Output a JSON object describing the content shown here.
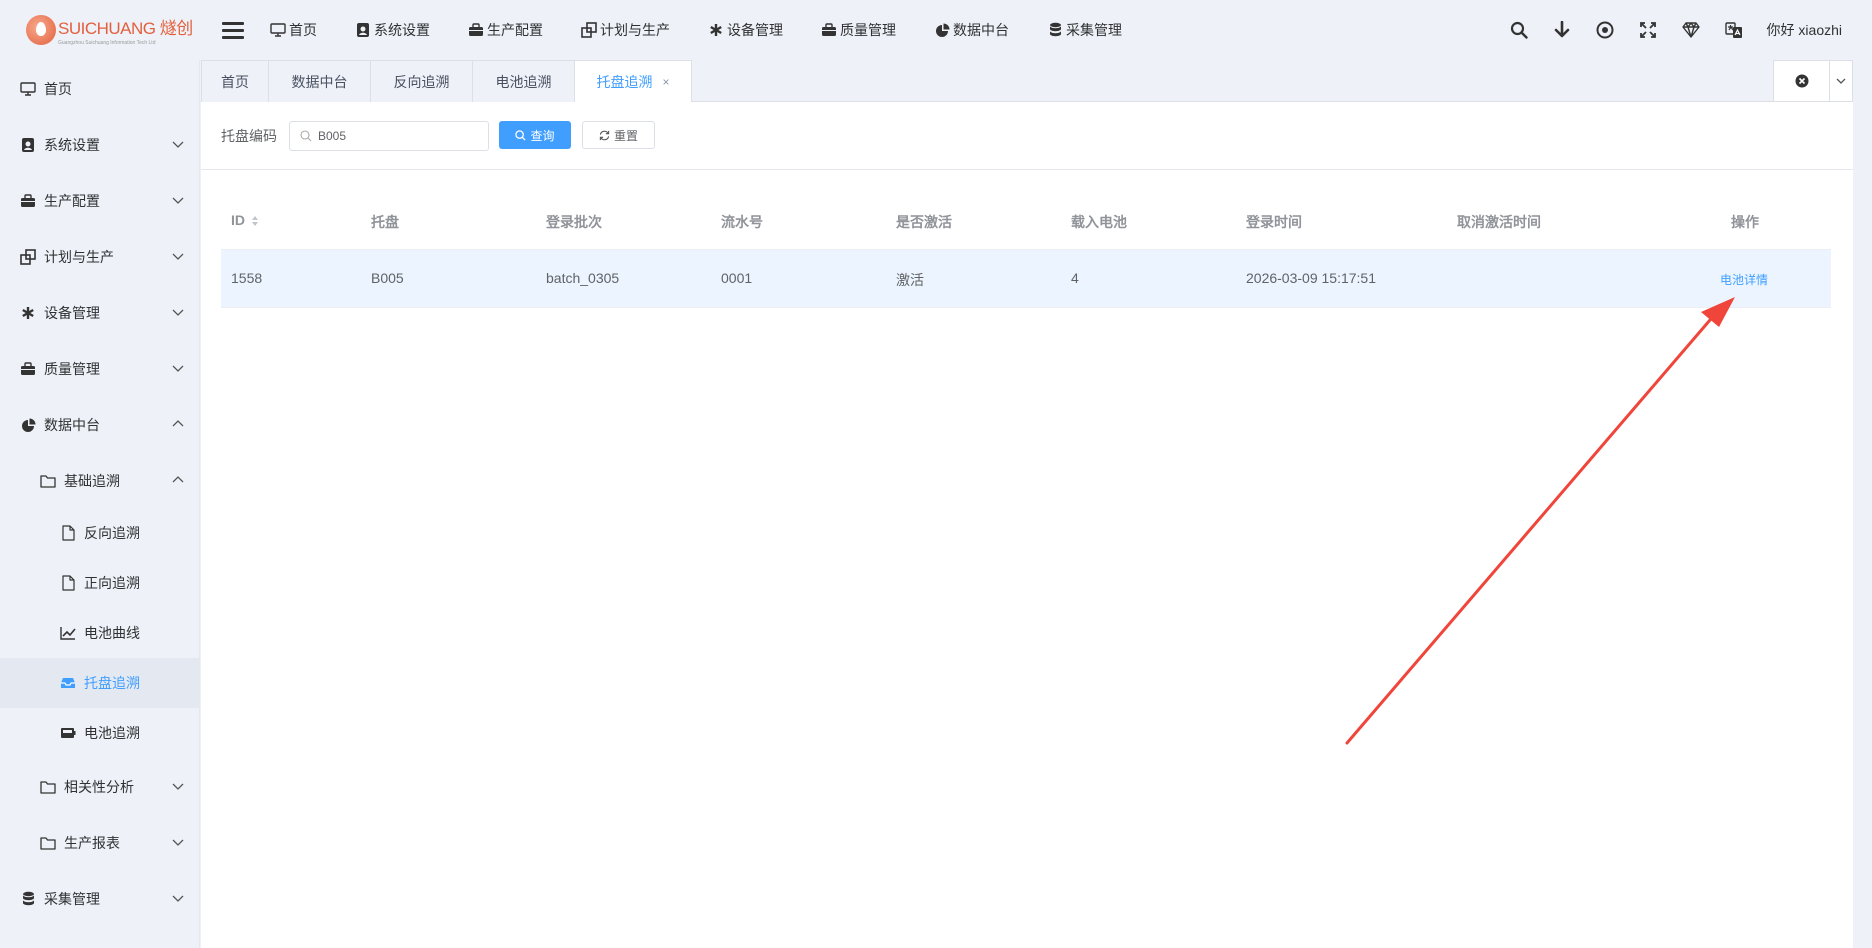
{
  "app": {
    "logo_text": "SUICHUANG 燧创",
    "logo_sub": "Guangzhou Suichuang Information Tech Ltd"
  },
  "topnav": [
    {
      "label": "首页",
      "icon": "monitor-icon"
    },
    {
      "label": "系统设置",
      "icon": "user-badge-icon"
    },
    {
      "label": "生产配置",
      "icon": "briefcase-icon"
    },
    {
      "label": "计划与生产",
      "icon": "layers-icon"
    },
    {
      "label": "设备管理",
      "icon": "asterisk-icon"
    },
    {
      "label": "质量管理",
      "icon": "briefcase-icon"
    },
    {
      "label": "数据中台",
      "icon": "pie-chart-icon"
    },
    {
      "label": "采集管理",
      "icon": "database-icon"
    }
  ],
  "topright": {
    "greeting": "你好 xiaozhi"
  },
  "sidebar": {
    "items": [
      {
        "label": "首页"
      },
      {
        "label": "系统设置"
      },
      {
        "label": "生产配置"
      },
      {
        "label": "计划与生产"
      },
      {
        "label": "设备管理"
      },
      {
        "label": "质量管理"
      },
      {
        "label": "数据中台"
      },
      {
        "label": "基础追溯"
      },
      {
        "label": "反向追溯"
      },
      {
        "label": "正向追溯"
      },
      {
        "label": "电池曲线"
      },
      {
        "label": "托盘追溯"
      },
      {
        "label": "电池追溯"
      },
      {
        "label": "相关性分析"
      },
      {
        "label": "生产报表"
      },
      {
        "label": "采集管理"
      }
    ]
  },
  "tabs": [
    {
      "label": "首页"
    },
    {
      "label": "数据中台"
    },
    {
      "label": "反向追溯"
    },
    {
      "label": "电池追溯"
    },
    {
      "label": "托盘追溯",
      "close": "×"
    }
  ],
  "search": {
    "label": "托盘编码",
    "value": "B005",
    "query_button": "查询",
    "reset_button": "重置"
  },
  "table": {
    "columns": [
      "ID",
      "托盘",
      "登录批次",
      "流水号",
      "是否激活",
      "载入电池",
      "登录时间",
      "取消激活时间",
      "操作"
    ],
    "rows": [
      {
        "id": "1558",
        "tray": "B005",
        "batch": "batch_0305",
        "serial": "0001",
        "active": "激活",
        "batteries": "4",
        "login_time": "2026-03-09 15:17:51",
        "deactivate_time": "",
        "action": "电池详情"
      }
    ]
  },
  "colors": {
    "accent": "#409eff",
    "annotation_arrow": "#f0453a"
  }
}
